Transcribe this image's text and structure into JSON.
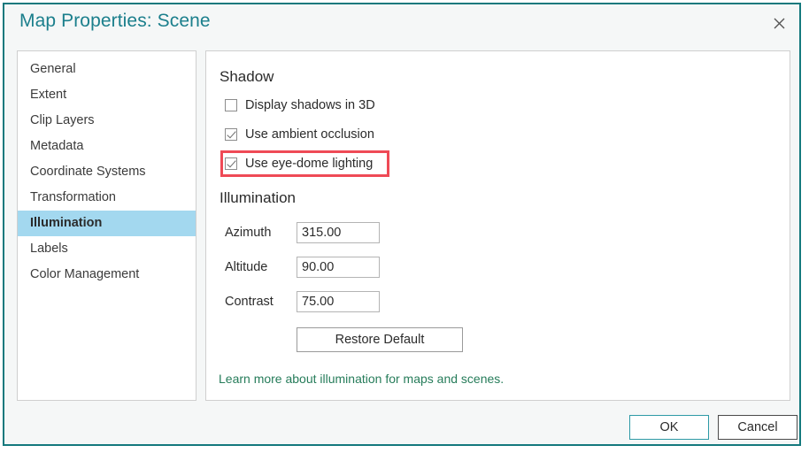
{
  "window": {
    "title": "Map Properties: Scene",
    "close_icon": "close-icon",
    "border_color": "#14797d",
    "title_color": "#1b7f8c"
  },
  "sidebar": {
    "items": [
      {
        "label": "General",
        "selected": false
      },
      {
        "label": "Extent",
        "selected": false
      },
      {
        "label": "Clip Layers",
        "selected": false
      },
      {
        "label": "Metadata",
        "selected": false
      },
      {
        "label": "Coordinate Systems",
        "selected": false
      },
      {
        "label": "Transformation",
        "selected": false
      },
      {
        "label": "Illumination",
        "selected": true
      },
      {
        "label": "Labels",
        "selected": false
      },
      {
        "label": "Color Management",
        "selected": false
      }
    ],
    "selected_background": "#a3d8ef"
  },
  "shadow": {
    "heading": "Shadow",
    "options": [
      {
        "label": "Display shadows in 3D",
        "checked": false
      },
      {
        "label": "Use ambient occlusion",
        "checked": true
      },
      {
        "label": "Use eye-dome lighting",
        "checked": true,
        "highlighted": true
      }
    ],
    "highlight_color": "#ef4a56"
  },
  "illumination": {
    "heading": "Illumination",
    "fields": [
      {
        "label": "Azimuth",
        "value": "315.00"
      },
      {
        "label": "Altitude",
        "value": "90.00"
      },
      {
        "label": "Contrast",
        "value": "75.00"
      }
    ],
    "restore_default_label": "Restore Default",
    "link_text": "Learn more about illumination for maps and scenes.",
    "link_color": "#267c5a"
  },
  "footer": {
    "ok_label": "OK",
    "cancel_label": "Cancel",
    "ok_border_color": "#2e9aa6"
  }
}
